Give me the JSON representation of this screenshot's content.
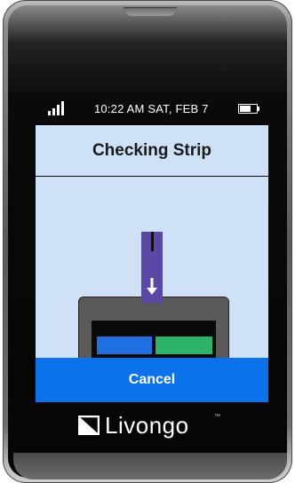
{
  "status_bar": {
    "datetime": "10:22 AM  SAT, FEB 7",
    "signal_icon": "signal-bars-icon",
    "battery_icon": "battery-icon",
    "battery_level": 0.7
  },
  "screen": {
    "title": "Checking Strip",
    "illustration_icons": [
      "test-strip-icon",
      "down-arrow-icon",
      "meter-icon"
    ],
    "cancel_label": "Cancel"
  },
  "brand": {
    "name": "Livongo",
    "trademark": "™",
    "logo_icon": "livongo-logo-icon"
  },
  "colors": {
    "screen_background": "#cfe1f7",
    "cancel_button": "#0b72eb",
    "strip": "#5b48a6",
    "meter_blue": "#1f6fe0",
    "meter_green": "#2db36a"
  }
}
